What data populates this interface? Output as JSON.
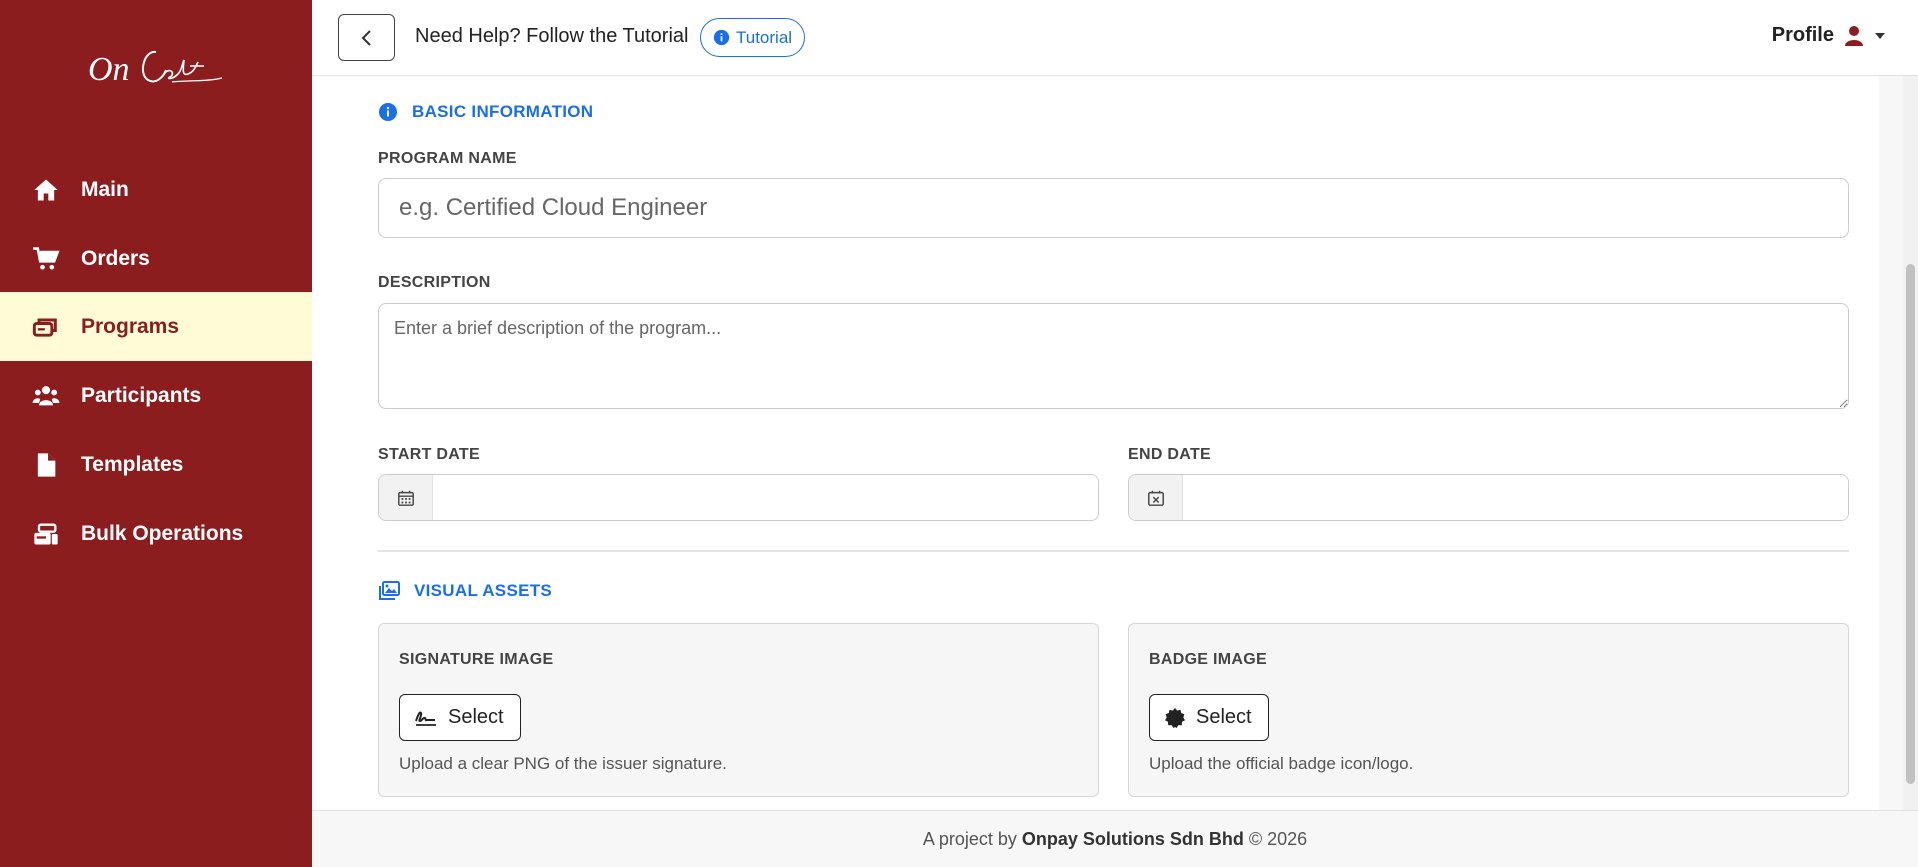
{
  "brand": {
    "logo_text": "OnCert",
    "color": "#8b1d1f"
  },
  "sidebar": {
    "items": [
      {
        "label": "Main",
        "icon": "home-icon",
        "active": false
      },
      {
        "label": "Orders",
        "icon": "cart-icon",
        "active": false
      },
      {
        "label": "Programs",
        "icon": "cards-icon",
        "active": true
      },
      {
        "label": "Participants",
        "icon": "users-icon",
        "active": false
      },
      {
        "label": "Templates",
        "icon": "file-icon",
        "active": false
      },
      {
        "label": "Bulk Operations",
        "icon": "bulk-icon",
        "active": false
      }
    ]
  },
  "header": {
    "help_text": "Need Help? Follow the Tutorial",
    "tutorial_label": "Tutorial",
    "profile_label": "Profile"
  },
  "form": {
    "basic_section_title": "BASIC INFORMATION",
    "program_name_label": "PROGRAM NAME",
    "program_name_placeholder": "e.g. Certified Cloud Engineer",
    "program_name_value": "",
    "description_label": "DESCRIPTION",
    "description_placeholder": "Enter a brief description of the program...",
    "description_value": "",
    "start_date_label": "START DATE",
    "start_date_value": "",
    "end_date_label": "END DATE",
    "end_date_value": "",
    "visual_section_title": "VISUAL ASSETS",
    "signature": {
      "label": "SIGNATURE IMAGE",
      "button_label": "Select",
      "hint": "Upload a clear PNG of the issuer signature."
    },
    "badge": {
      "label": "BADGE IMAGE",
      "button_label": "Select",
      "hint": "Upload the official badge icon/logo."
    }
  },
  "footer": {
    "prefix": "A project by",
    "company": "Onpay Solutions Sdn Bhd",
    "suffix": "© 2026"
  },
  "colors": {
    "sidebar_bg": "#8b1d1f",
    "active_item_bg": "#fffbd6",
    "accent_blue": "#1a6ee8"
  }
}
